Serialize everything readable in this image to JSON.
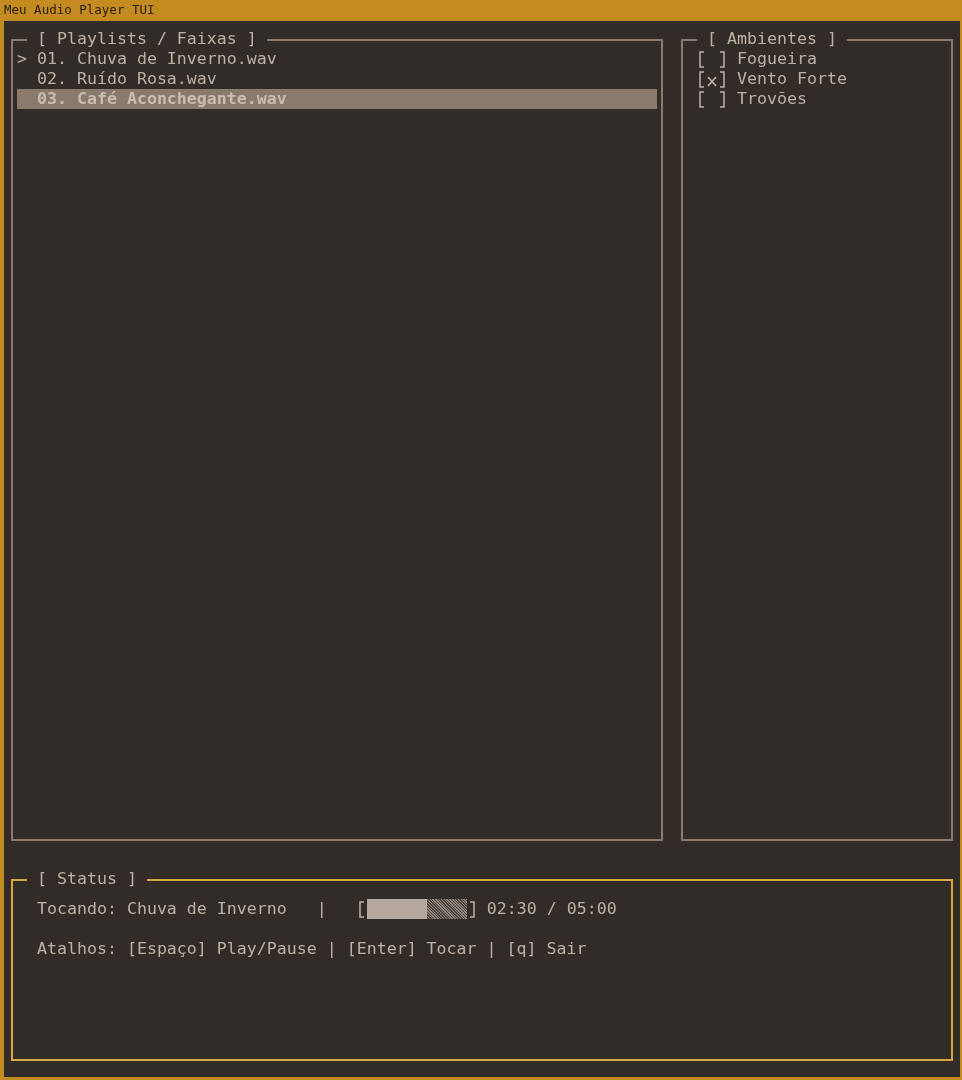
{
  "window": {
    "title": "Meu Audio Player TUI"
  },
  "playlist": {
    "title": "[ Playlists / Faixas ]",
    "items": [
      {
        "marker": ">",
        "label": "01. Chuva de Inverno.wav",
        "selected": false
      },
      {
        "label": "02. Ruído Rosa.wav",
        "selected": false
      },
      {
        "label": "03. Café Aconchegante.wav",
        "selected": true
      }
    ]
  },
  "ambients": {
    "title": "[ Ambientes ]",
    "items": [
      {
        "label": "Fogueira",
        "checked": false
      },
      {
        "label": "Vento Forte",
        "checked": true
      },
      {
        "label": "Trovões",
        "checked": false
      }
    ]
  },
  "status": {
    "title": "[ Status ]",
    "now_playing": "Tocando: Chuva de Inverno",
    "separator": "|",
    "progress": {
      "level": 0.6
    },
    "time": "02:30 / 05:00",
    "shortcuts": "Atalhos: [Espaço] Play/Pause | [Enter] Tocar | [q] Sair"
  }
}
